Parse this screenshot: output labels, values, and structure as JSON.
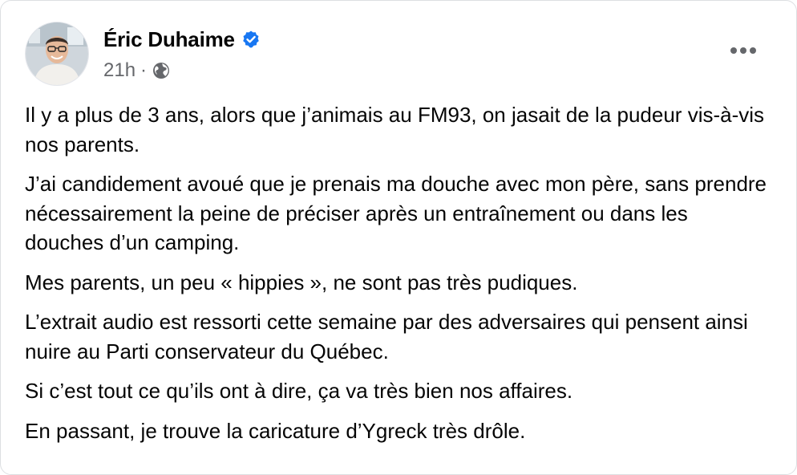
{
  "post": {
    "author_name": "Éric Duhaime",
    "verified_icon": "verified-badge-icon",
    "timestamp": "21h",
    "separator": "·",
    "audience_icon": "globe-icon",
    "more_icon": "more-options-icon",
    "paragraphs": [
      "Il y a plus de 3 ans, alors que j’animais au FM93, on jasait de la pudeur vis-à-vis nos parents.",
      "J’ai candidement avoué que je prenais ma douche avec mon père, sans prendre nécessairement la peine de préciser après un entraînement ou dans les douches d’un camping.",
      "Mes parents, un peu « hippies », ne sont pas très pudiques.",
      "L’extrait audio est ressorti cette semaine par des adversaires qui pensent ainsi nuire au Parti conservateur du Québec.",
      "Si c’est tout ce qu’ils ont à dire, ça va très bien nos affaires.",
      "En passant, je trouve la caricature d’Ygreck très drôle."
    ]
  },
  "colors": {
    "text_primary": "#050505",
    "text_secondary": "#65676b",
    "verified_blue": "#1877f2",
    "border": "#dddfe2"
  }
}
